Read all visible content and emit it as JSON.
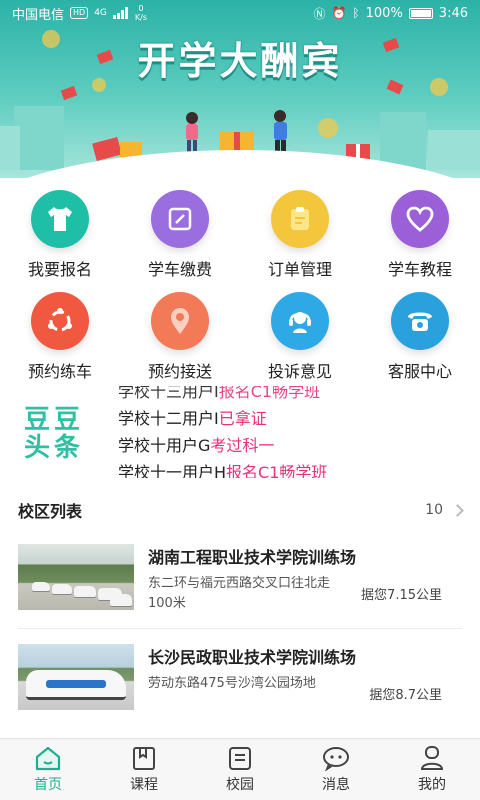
{
  "status_bar": {
    "carrier": "中国电信",
    "hd_badge": "HD",
    "signal": "4G",
    "net_speed_value": "0",
    "net_speed_unit": "K/s",
    "battery": "100%",
    "time": "3:46"
  },
  "banner": {
    "title": "开学大酬宾"
  },
  "menu": [
    {
      "label": "我要报名",
      "icon": "tshirt-icon",
      "color": "#1fbfa7"
    },
    {
      "label": "学车缴费",
      "icon": "edit-icon",
      "color": "#9b6ee0"
    },
    {
      "label": "订单管理",
      "icon": "clipboard-icon",
      "color": "#f3c63c"
    },
    {
      "label": "学车教程",
      "icon": "heart-icon",
      "color": "#9b5fd8"
    },
    {
      "label": "预约练车",
      "icon": "cycle-icon",
      "color": "#f0593f"
    },
    {
      "label": "预约接送",
      "icon": "location-pin-icon",
      "color": "#f37a56"
    },
    {
      "label": "投诉意见",
      "icon": "headset-icon",
      "color": "#2ea9e6"
    },
    {
      "label": "客服中心",
      "icon": "phone-icon",
      "color": "#2aa0dd"
    }
  ],
  "news": {
    "logo_line1": "豆豆",
    "logo_line2": "头条",
    "items": [
      {
        "user": "学校十三用户I",
        "action": "报名C1畅学班"
      },
      {
        "user": "学校十二用户I",
        "action": "已拿证"
      },
      {
        "user": "学校十用户G",
        "action": "考过科一"
      },
      {
        "user": "学校十一用户H",
        "action": "报名C1畅学班"
      }
    ]
  },
  "campus_section": {
    "title": "校区列表",
    "count": "10"
  },
  "campuses": [
    {
      "name": "湖南工程职业技术学院训练场",
      "address": "东二环与福元西路交叉口往北走100米",
      "distance": "据您7.15公里"
    },
    {
      "name": "长沙民政职业技术学院训练场",
      "address": "劳动东路475号沙湾公园场地",
      "distance": "据您8.7公里"
    }
  ],
  "tabs": [
    {
      "label": "首页",
      "icon": "home-icon",
      "active": true
    },
    {
      "label": "课程",
      "icon": "book-icon",
      "active": false
    },
    {
      "label": "校园",
      "icon": "campus-icon",
      "active": false
    },
    {
      "label": "消息",
      "icon": "chat-icon",
      "active": false
    },
    {
      "label": "我的",
      "icon": "user-icon",
      "active": false
    }
  ],
  "colors": {
    "brand": "#1fae8f",
    "highlight": "#e9307e",
    "banner_top": "#2bb2a7"
  }
}
